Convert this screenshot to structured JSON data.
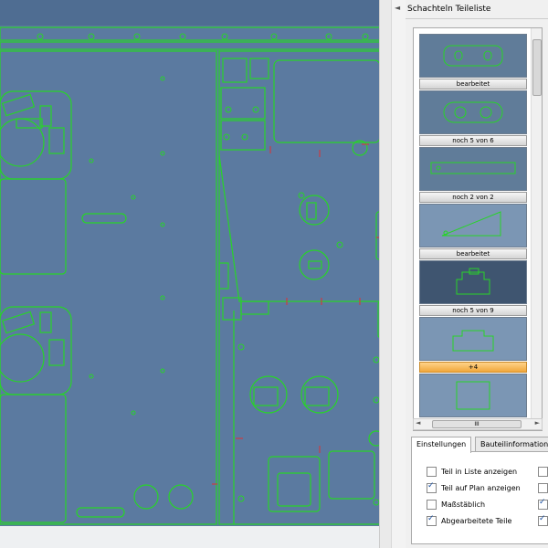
{
  "panel": {
    "title": "Schachteln Teileliste"
  },
  "parts": [
    {
      "label": "bearbeitet",
      "highlight": false
    },
    {
      "label": "noch 5 von 6",
      "highlight": false
    },
    {
      "label": "noch 2 von 2",
      "highlight": false
    },
    {
      "label": "bearbeitet",
      "highlight": false
    },
    {
      "label": "noch 5 von 9",
      "highlight": false
    },
    {
      "label": "+4",
      "highlight": true
    },
    {
      "label": "",
      "highlight": false
    }
  ],
  "hscroll": {
    "grip": "III"
  },
  "tabs": [
    {
      "label": "Einstellungen",
      "active": true
    },
    {
      "label": "Bauteilinformatione",
      "active": false
    }
  ],
  "options": [
    {
      "label": "Teil in Liste anzeigen",
      "checked": false,
      "checked2": false
    },
    {
      "label": "Teil auf Plan anzeigen",
      "checked": true,
      "checked2": false
    },
    {
      "label": "Maßstäblich",
      "checked": false,
      "checked2": true
    },
    {
      "label": "Abgearbeitete Teile",
      "checked": true,
      "checked2": true
    }
  ],
  "colors": {
    "sheet": "#5b7aa0",
    "contour": "#28d428",
    "marker": "#e03030"
  }
}
